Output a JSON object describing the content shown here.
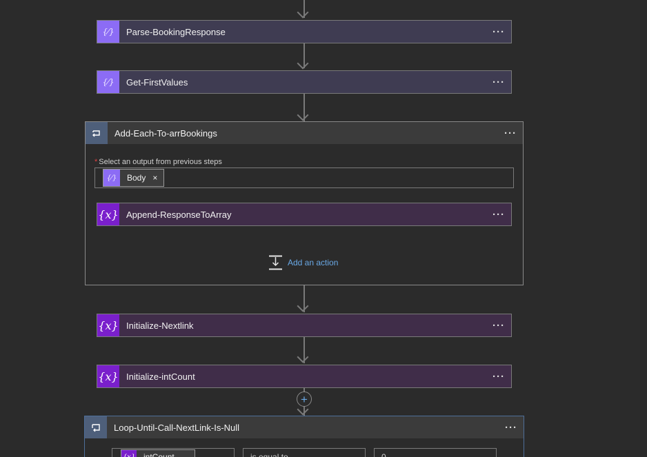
{
  "flow": {
    "steps": [
      {
        "title": "Parse-BookingResponse",
        "kind": "parse-json"
      },
      {
        "title": "Get-FirstValues",
        "kind": "parse-json"
      }
    ],
    "foreach_scope": {
      "title": "Add-Each-To-arrBookings",
      "field_label": "Select an output from previous steps",
      "required_mark": "*",
      "token_label": "Body",
      "token_remove": "×",
      "inner_action": "Append-ResponseToArray",
      "add_action_label": "Add an action"
    },
    "steps_after": [
      {
        "title": "Initialize-Nextlink",
        "kind": "variable"
      },
      {
        "title": "Initialize-intCount",
        "kind": "variable"
      }
    ],
    "until_scope": {
      "title": "Loop-Until-Call-NextLink-Is-Null",
      "condition_token": "intCount",
      "condition_operator": "is equal to",
      "condition_value": "0"
    },
    "menu_glyph": "···",
    "insert_glyph": "+"
  },
  "icons": {
    "parse": "parse-json-icon",
    "variable": "variable-icon",
    "foreach": "foreach-loop-icon",
    "until": "until-loop-icon",
    "add_action": "add-action-icon"
  },
  "colors": {
    "canvas": "#2b2b2b",
    "parse_accent": "#8c6cf5",
    "variable_accent": "#7a1fcc",
    "scope_accent": "#4e5f7a",
    "link": "#6aa9e6"
  }
}
